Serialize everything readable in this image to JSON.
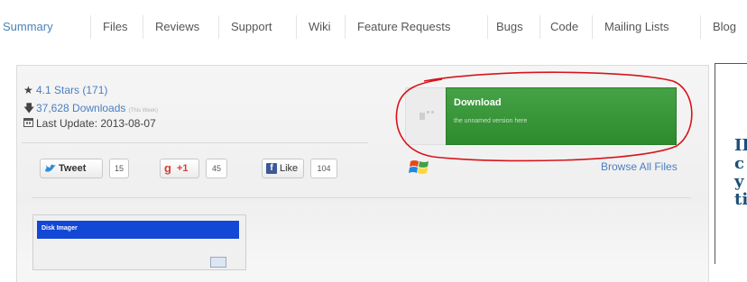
{
  "tabs": [
    {
      "label": "Summary"
    },
    {
      "label": "Files"
    },
    {
      "label": "Reviews"
    },
    {
      "label": "Support"
    },
    {
      "label": "Wiki"
    },
    {
      "label": "Feature Requests"
    },
    {
      "label": "Bugs"
    },
    {
      "label": "Code"
    },
    {
      "label": "Mailing Lists"
    },
    {
      "label": "Blog"
    }
  ],
  "stats": {
    "stars": "4.1 Stars (171)",
    "downloads": "37,628 Downloads",
    "downloads_note": "(This Week)",
    "last_update": "Last Update: 2013-08-07"
  },
  "social": {
    "tweet": "Tweet",
    "tweet_count": "15",
    "gplus": "+1",
    "gplus_count": "45",
    "like": "Like",
    "like_count": "104"
  },
  "download": {
    "title": "Download",
    "subtitle": "the unnamed version here"
  },
  "browse_label": "Browse All Files",
  "thumbnail_title": "Disk Imager",
  "side_text": [
    "II",
    "c",
    "y",
    "ti"
  ],
  "colors": {
    "link": "#4a7fc0",
    "download_green": "#3a9a3a",
    "highlight_circle": "#d8141c",
    "twitter": "#2f8fd8",
    "gplus": "#d73d32",
    "facebook": "#3b5998"
  },
  "icons": [
    "star-icon",
    "download-arrow-icon",
    "calendar-icon",
    "twitter-bird-icon",
    "google-plus-icon",
    "facebook-icon",
    "windows-logo-icon",
    "download-ghost-icon"
  ]
}
